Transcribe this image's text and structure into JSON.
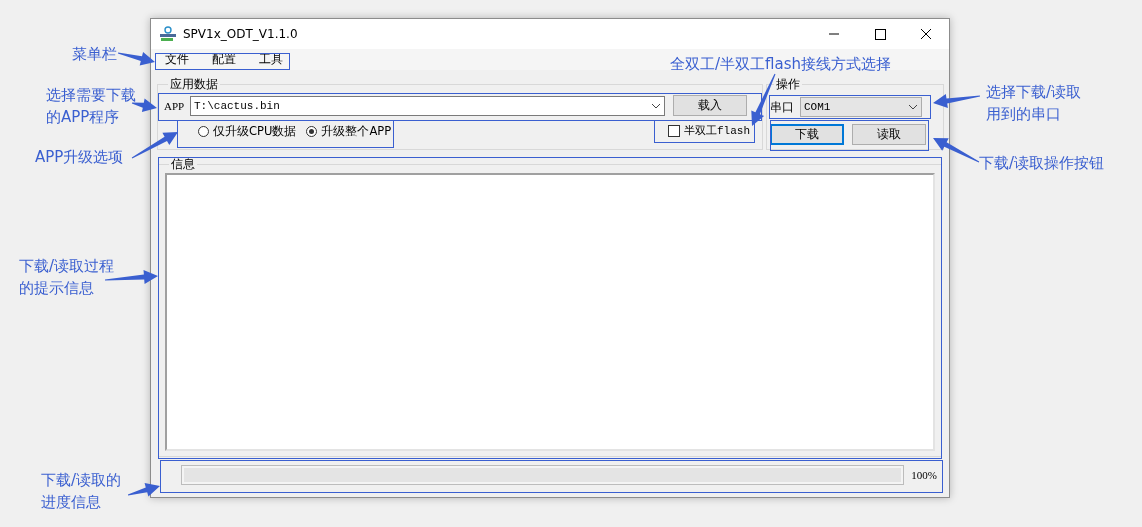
{
  "window": {
    "title": "SPV1x_ODT_V1.1.0"
  },
  "menu": [
    "文件",
    "配置",
    "工具"
  ],
  "app_data": {
    "title": "应用数据",
    "app_label": "APP",
    "file_path": "T:\\cactus.bin",
    "load_button": "载入",
    "upgrade_options": [
      {
        "label": "仅升级CPU数据",
        "selected": false
      },
      {
        "label": "升级整个APP",
        "selected": true
      }
    ],
    "half_duplex": {
      "label": "半双工flash",
      "checked": false
    }
  },
  "operation": {
    "title": "操作",
    "port_label": "串口",
    "port": "COM1",
    "buttons": [
      {
        "label": "下载",
        "focused": true
      },
      {
        "label": "读取",
        "focused": false
      }
    ]
  },
  "info": {
    "title": "信息"
  },
  "progress": {
    "level": 1,
    "reading": "100%"
  },
  "annotations": [
    {
      "text": "菜单栏"
    },
    {
      "text": "选择需要下载的APP程序"
    },
    {
      "text": "APP升级选项"
    },
    {
      "text": "全双工/半双工flash接线方式选择"
    },
    {
      "text": "选择下载/读取用到的串口"
    },
    {
      "text": "下载/读取操作按钮"
    },
    {
      "text": "下载/读取过程的提示信息"
    },
    {
      "text": "下载/读取的进度信息"
    }
  ]
}
